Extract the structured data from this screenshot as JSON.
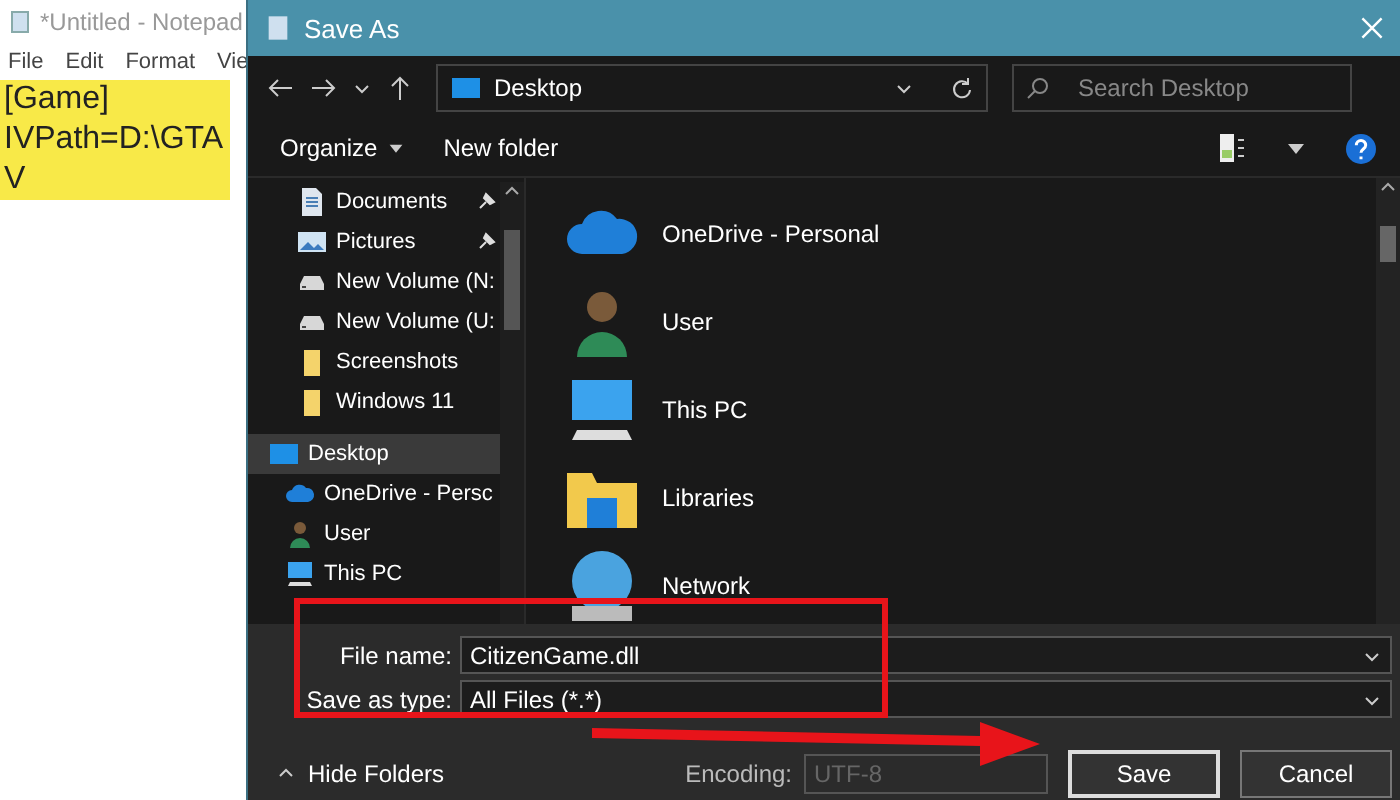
{
  "notepad": {
    "title": "*Untitled - Notepad",
    "menu": [
      "File",
      "Edit",
      "Format",
      "Vie"
    ],
    "lines": [
      {
        "text": "[Game]",
        "highlighted": true
      },
      {
        "text": "IVPath=D:\\GTA V",
        "highlighted": true
      }
    ]
  },
  "dialog": {
    "title": "Save As",
    "address": {
      "location": "Desktop"
    },
    "search": {
      "placeholder": "Search Desktop"
    },
    "toolbar": {
      "organize": "Organize",
      "new_folder": "New folder"
    },
    "sidebar": {
      "quick_access": [
        {
          "label": "Documents",
          "kind": "document",
          "pinned": true,
          "selected": false
        },
        {
          "label": "Pictures",
          "kind": "pictures",
          "pinned": true,
          "selected": false
        },
        {
          "label": "New Volume (N:",
          "kind": "drive",
          "pinned": false,
          "selected": false
        },
        {
          "label": "New Volume (U:",
          "kind": "drive",
          "pinned": false,
          "selected": false
        },
        {
          "label": "Screenshots",
          "kind": "folder",
          "pinned": false,
          "selected": false
        },
        {
          "label": "Windows 11",
          "kind": "folder",
          "pinned": false,
          "selected": false
        }
      ],
      "tree": [
        {
          "label": "Desktop",
          "kind": "desktop",
          "selected": true,
          "children": [
            {
              "label": "OneDrive - Persc",
              "kind": "cloud",
              "selected": false
            },
            {
              "label": "User",
              "kind": "user",
              "selected": false
            },
            {
              "label": "This PC",
              "kind": "pc",
              "selected": false
            }
          ]
        }
      ]
    },
    "items": [
      {
        "label": "OneDrive - Personal",
        "kind": "cloud"
      },
      {
        "label": "User",
        "kind": "user"
      },
      {
        "label": "This PC",
        "kind": "pc"
      },
      {
        "label": "Libraries",
        "kind": "library"
      },
      {
        "label": "Network",
        "kind": "network"
      }
    ],
    "file_name": {
      "label": "File name:",
      "value": "CitizenGame.dll"
    },
    "save_as_type": {
      "label": "Save as type:",
      "value": "All Files  (*.*)"
    },
    "hide_folders": "Hide Folders",
    "encoding": {
      "label": "Encoding:",
      "value": "UTF-8",
      "disabled": true
    },
    "buttons": [
      {
        "label": "Save",
        "default": true
      },
      {
        "label": "Cancel",
        "default": false
      }
    ]
  },
  "annotations": {
    "box_around_fields": true,
    "arrow_to_save": true
  }
}
